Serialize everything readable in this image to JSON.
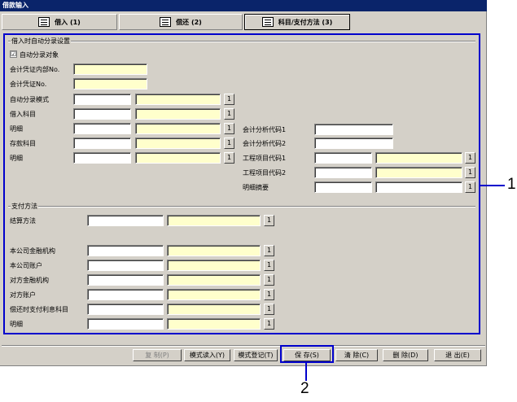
{
  "window": {
    "title": "借款输入"
  },
  "tabs": [
    {
      "label": "借入 (1)",
      "icon": "book-icon"
    },
    {
      "label": "偿还 (2)",
      "icon": "document-icon"
    },
    {
      "label": "科目/支付方法 (3)",
      "icon": "form-icon"
    }
  ],
  "auto": {
    "group_title": "借入时自动分录设置",
    "checkbox_label": "自动分录对象",
    "checkbox_checked": true,
    "checkbox_mark": "☑",
    "labels": {
      "internal_no": "会计凭证内部No.",
      "voucher_no": "会计凭证No.",
      "template": "自动分录模式",
      "borrow_account": "借入科目",
      "detail": "明细",
      "deposit_account": "存款科目",
      "detail2": "明细",
      "analysis1": "会计分析代码1",
      "analysis2": "会计分析代码2",
      "project1": "工程项目代码1",
      "project2": "工程项目代码2",
      "summary": "明细摘要"
    }
  },
  "pay": {
    "group_title": "支付方法",
    "labels": {
      "settle": "结算方法",
      "bank": "本公司金融机构",
      "account": "本公司账户",
      "other_bank": "对方金融机构",
      "other_account": "对方账户",
      "interest_account": "偿还时支付利息科目",
      "detail": "明细"
    }
  },
  "lookup_label": "1",
  "buttons": {
    "copy": "复 制(P)",
    "template_read": "模式读入(Y)",
    "template_register": "模式登记(T)",
    "save": "保 存(S)",
    "clear": "清 除(C)",
    "delete": "删 除(D)",
    "exit": "退 出(E)"
  },
  "callouts": {
    "one": "1",
    "two": "2"
  },
  "colors": {
    "frame": "#0000cc",
    "title_bar": "#0a246a",
    "field_yellow": "#ffffcc"
  }
}
